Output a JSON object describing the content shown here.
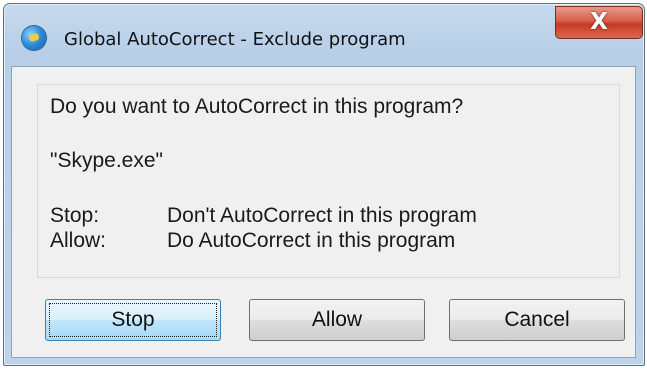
{
  "window": {
    "title": "Global AutoCorrect - Exclude program",
    "close_symbol": "X",
    "icon": "globe-icon"
  },
  "message": {
    "question": "Do you want to AutoCorrect in this program?",
    "program": "\"Skype.exe\"",
    "definitions": [
      {
        "term": "Stop:",
        "description": "Don't AutoCorrect in this program"
      },
      {
        "term": "Allow:",
        "description": "Do AutoCorrect in this program"
      }
    ]
  },
  "buttons": {
    "stop": "Stop",
    "allow": "Allow",
    "cancel": "Cancel"
  },
  "colors": {
    "close_button": "#c63a24",
    "default_button": "#bee6fd"
  }
}
